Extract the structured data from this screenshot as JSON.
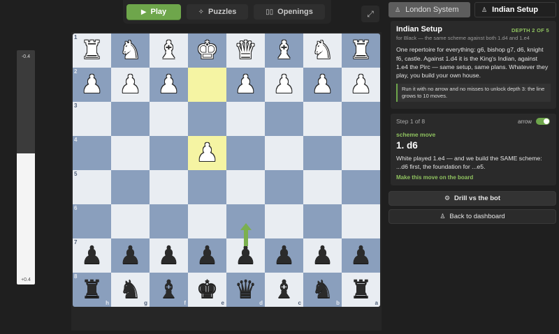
{
  "nav": {
    "play": "Play",
    "puzzles": "Puzzles",
    "openings": "Openings"
  },
  "eval": {
    "top": "-0.4",
    "bottom": "+0.4",
    "white_share": 0.56
  },
  "board": {
    "ranks": [
      "1",
      "2",
      "3",
      "4",
      "5",
      "6",
      "7",
      "8"
    ],
    "files": [
      "h",
      "g",
      "f",
      "e",
      "d",
      "c",
      "b",
      "a"
    ],
    "rows": [
      [
        {
          "g": "♜",
          "c": "w"
        },
        {
          "g": "♞",
          "c": "w"
        },
        {
          "g": "♝",
          "c": "w"
        },
        {
          "g": "♚",
          "c": "w"
        },
        {
          "g": "♛",
          "c": "w"
        },
        {
          "g": "♝",
          "c": "w"
        },
        {
          "g": "♞",
          "c": "w"
        },
        {
          "g": "♜",
          "c": "w"
        }
      ],
      [
        {
          "g": "♟",
          "c": "w"
        },
        {
          "g": "♟",
          "c": "w"
        },
        {
          "g": "♟",
          "c": "w"
        },
        null,
        {
          "g": "♟",
          "c": "w"
        },
        {
          "g": "♟",
          "c": "w"
        },
        {
          "g": "♟",
          "c": "w"
        },
        {
          "g": "♟",
          "c": "w"
        }
      ],
      [
        null,
        null,
        null,
        null,
        null,
        null,
        null,
        null
      ],
      [
        null,
        null,
        null,
        {
          "g": "♟",
          "c": "w"
        },
        null,
        null,
        null,
        null
      ],
      [
        null,
        null,
        null,
        null,
        null,
        null,
        null,
        null
      ],
      [
        null,
        null,
        null,
        null,
        null,
        null,
        null,
        null
      ],
      [
        {
          "g": "♟",
          "c": "b"
        },
        {
          "g": "♟",
          "c": "b"
        },
        {
          "g": "♟",
          "c": "b"
        },
        {
          "g": "♟",
          "c": "b"
        },
        {
          "g": "♟",
          "c": "b"
        },
        {
          "g": "♟",
          "c": "b"
        },
        {
          "g": "♟",
          "c": "b"
        },
        {
          "g": "♟",
          "c": "b"
        }
      ],
      [
        {
          "g": "♜",
          "c": "b"
        },
        {
          "g": "♞",
          "c": "b"
        },
        {
          "g": "♝",
          "c": "b"
        },
        {
          "g": "♚",
          "c": "b"
        },
        {
          "g": "♛",
          "c": "b"
        },
        {
          "g": "♝",
          "c": "b"
        },
        {
          "g": "♞",
          "c": "b"
        },
        {
          "g": "♜",
          "c": "b"
        }
      ]
    ],
    "highlights": [
      "e2",
      "e4"
    ],
    "arrow": {
      "from": "d7",
      "to": "d6",
      "color": "#7bb04f"
    },
    "colors": {
      "light": "#e9edf2",
      "dark": "#8a9fbd",
      "highlight": "#f5f4a3"
    }
  },
  "tabs": {
    "london": "London System",
    "indian": "Indian Setup"
  },
  "repertoire": {
    "title": "Indian Setup",
    "depth": "DEPTH 2 OF 5",
    "subtitle": "for Black — the same scheme against both 1.d4 and 1.e4",
    "body": "One repertoire for everything: g6, bishop g7, d6, knight f6, castle. Against 1.d4 it is the King's Indian, against 1.e4 the Pirc — same setup, same plans. Whatever they play, you build your own house.",
    "note": "Run it with no arrow and no misses to unlock depth 3: the line grows to 10 moves."
  },
  "step": {
    "label": "Step 1 of 8",
    "arrow_label": "arrow",
    "arrow_on": true,
    "scheme_label": "scheme move",
    "move": "1. d6",
    "text": "White played 1.e4 — and we build the SAME scheme: ...d6 first, the foundation for ...e5.",
    "cta": "Make this move on the board"
  },
  "actions": {
    "drill": "Drill vs the bot",
    "back": "Back to dashboard"
  },
  "accent": "#6ea64b"
}
